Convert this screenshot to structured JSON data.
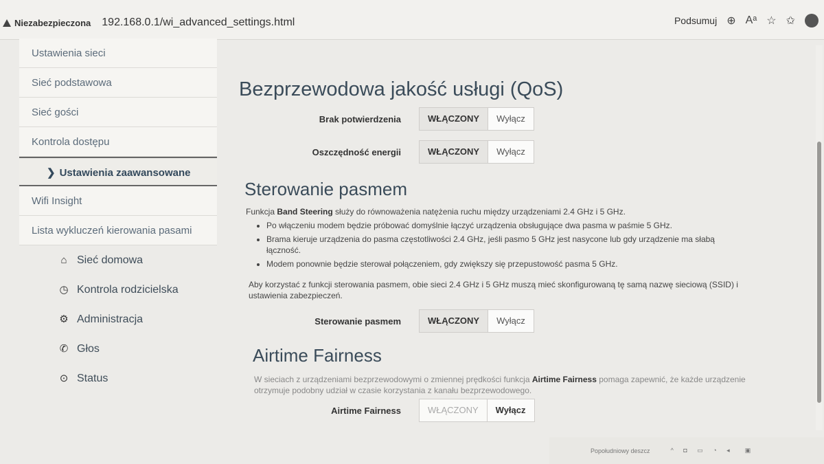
{
  "browser": {
    "security_label": "Niezabezpieczona",
    "url": "192.168.0.1/wi_advanced_settings.html",
    "summarize_label": "Podsumuj"
  },
  "sidebar": {
    "sub_items": [
      {
        "label": "Ustawienia sieci"
      },
      {
        "label": "Sieć podstawowa"
      },
      {
        "label": "Sieć gości"
      },
      {
        "label": "Kontrola dostępu"
      },
      {
        "label": "Ustawienia zaawansowane"
      },
      {
        "label": "Wifi Insight"
      },
      {
        "label": "Lista wykluczeń kierowania pasami"
      }
    ],
    "main_items": [
      {
        "label": "Sieć domowa",
        "icon": "home-icon"
      },
      {
        "label": "Kontrola rodzicielska",
        "icon": "clock-icon"
      },
      {
        "label": "Administracja",
        "icon": "gear-icon"
      },
      {
        "label": "Głos",
        "icon": "phone-icon"
      },
      {
        "label": "Status",
        "icon": "status-icon"
      }
    ]
  },
  "qos": {
    "title": "Bezprzewodowa jakość usługi (QoS)",
    "no_ack_label": "Brak potwierdzenia",
    "power_save_label": "Oszczędność energii",
    "on_label": "WŁĄCZONY",
    "off_label": "Wyłącz"
  },
  "band_steering": {
    "title": "Sterowanie pasmem",
    "intro_pre": "Funkcja ",
    "intro_bold": "Band Steering",
    "intro_post": " służy do równoważenia natężenia ruchu między urządzeniami 2.4  GHz i 5  GHz.",
    "bullets": [
      "Po włączeniu modem będzie próbować domyślnie łączyć urządzenia obsługujące dwa pasma w paśmie 5  GHz.",
      "Brama kieruje urządzenia do pasma częstotliwości 2.4  GHz, jeśli pasmo 5  GHz jest nasycone lub gdy urządzenie ma słabą łączność.",
      "Modem ponownie będzie sterował połączeniem, gdy zwiększy się przepustowość pasma 5  GHz."
    ],
    "note": "Aby korzystać z funkcji sterowania pasmem, obie sieci 2.4  GHz i 5  GHz muszą mieć skonfigurowaną tę samą nazwę sieciową (SSID) i ustawienia zabezpieczeń.",
    "toggle_label": "Sterowanie pasmem",
    "on_label": "WŁĄCZONY",
    "off_label": "Wyłącz"
  },
  "airtime": {
    "title": "Airtime Fairness",
    "desc_pre": "W sieciach z urządzeniami bezprzewodowymi o zmiennej prędkości funkcja ",
    "desc_bold": "Airtime Fairness",
    "desc_post": " pomaga zapewnić, że każde urządzenie otrzymuje podobny udział w czasie korzystania z kanału bezprzewodowego.",
    "toggle_label": "Airtime Fairness",
    "on_label": "WŁĄCZONY",
    "off_label": "Wyłącz"
  },
  "taskbar": {
    "weather": "Popołudniowy deszcz"
  }
}
